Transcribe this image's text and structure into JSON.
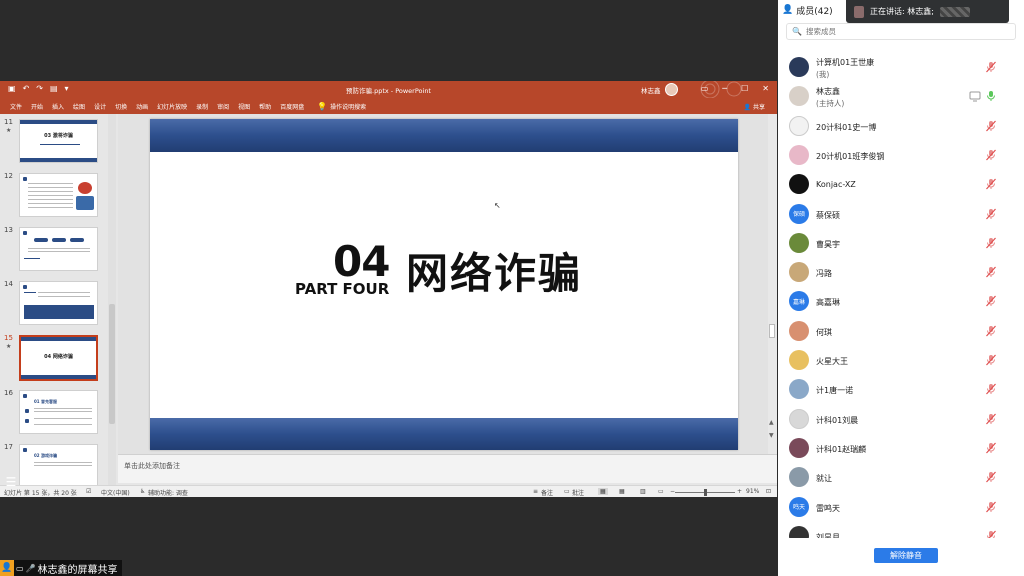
{
  "powerpoint": {
    "doc_title": "预防诈骗.pptx - PowerPoint",
    "user_name": "林志鑫",
    "share_label": "共享",
    "tabs": [
      "文件",
      "开始",
      "插入",
      "绘图",
      "设计",
      "切换",
      "动画",
      "幻灯片放映",
      "录制",
      "审阅",
      "视图",
      "帮助",
      "百度网盘"
    ],
    "tell_me": "操作说明搜索",
    "thumbnails": [
      {
        "num": "11",
        "star": "★",
        "title": "03 激将诈骗"
      },
      {
        "num": "12",
        "star": "",
        "title": ""
      },
      {
        "num": "13",
        "star": "",
        "title": ""
      },
      {
        "num": "14",
        "star": "",
        "title": ""
      },
      {
        "num": "15",
        "star": "★",
        "title": "04 网络诈骗"
      },
      {
        "num": "16",
        "star": "",
        "title": "01 冒充客服"
      },
      {
        "num": "17",
        "star": "",
        "title": "02 游戏诈骗"
      }
    ],
    "slide": {
      "number": "04",
      "part": "PART FOUR",
      "title": "网络诈骗"
    },
    "notes_placeholder": "单击此处添加备注",
    "status": {
      "slide_info": "幻灯片 第 15 张，共 20 张",
      "language": "中文(中国)",
      "accessibility": "辅助功能: 调查",
      "notes_btn": "备注",
      "comments_btn": "批注",
      "zoom": "91%"
    }
  },
  "overlay": {
    "screen_share_label": "林志鑫的屏幕共享"
  },
  "members_panel": {
    "title": "成员(42)",
    "search_placeholder": "搜索成员",
    "speaking_prefix": "正在讲话: 林志鑫;",
    "unmute_button": "解除静音",
    "members": [
      {
        "name": "计算机01王世康",
        "role": "(我)",
        "avatar_text": "",
        "avatar_color": "#2a3a5a",
        "mic": "muted"
      },
      {
        "name": "林志鑫",
        "role": "(主持人)",
        "avatar_text": "",
        "avatar_color": "#d8d0c8",
        "mic": "on",
        "cam": "screen"
      },
      {
        "name": "20计科01史一博",
        "role": "",
        "avatar_text": "",
        "avatar_color": "#f2f2f2",
        "mic": "muted"
      },
      {
        "name": "20计机01班李俊钢",
        "role": "",
        "avatar_text": "",
        "avatar_color": "#e8b8c8",
        "mic": "muted"
      },
      {
        "name": "Konjac-XZ",
        "role": "",
        "avatar_text": "",
        "avatar_color": "#111111",
        "mic": "muted"
      },
      {
        "name": "蔡保硕",
        "role": "",
        "avatar_text": "保硕",
        "avatar_color": "#2b7be8",
        "mic": "muted"
      },
      {
        "name": "曹昊宇",
        "role": "",
        "avatar_text": "",
        "avatar_color": "#6a8a3a",
        "mic": "muted"
      },
      {
        "name": "冯路",
        "role": "",
        "avatar_text": "",
        "avatar_color": "#c8a878",
        "mic": "muted"
      },
      {
        "name": "高嘉琳",
        "role": "",
        "avatar_text": "嘉琳",
        "avatar_color": "#2b7be8",
        "mic": "muted"
      },
      {
        "name": "何琪",
        "role": "",
        "avatar_text": "",
        "avatar_color": "#d89070",
        "mic": "muted"
      },
      {
        "name": "火星大王",
        "role": "",
        "avatar_text": "",
        "avatar_color": "#e8c060",
        "mic": "muted"
      },
      {
        "name": "计1唐一诺",
        "role": "",
        "avatar_text": "",
        "avatar_color": "#8aa8c8",
        "mic": "muted"
      },
      {
        "name": "计科01刘晨",
        "role": "",
        "avatar_text": "",
        "avatar_color": "#d8d8d8",
        "mic": "muted"
      },
      {
        "name": "计科01赵瑞麟",
        "role": "",
        "avatar_text": "",
        "avatar_color": "#7a4a5a",
        "mic": "muted"
      },
      {
        "name": "就让",
        "role": "",
        "avatar_text": "",
        "avatar_color": "#8a9aa8",
        "mic": "muted"
      },
      {
        "name": "雷鸣天",
        "role": "",
        "avatar_text": "鸣天",
        "avatar_color": "#2b7be8",
        "mic": "muted"
      },
      {
        "name": "刘昊月",
        "role": "",
        "avatar_text": "",
        "avatar_color": "#333333",
        "mic": "muted"
      }
    ]
  }
}
